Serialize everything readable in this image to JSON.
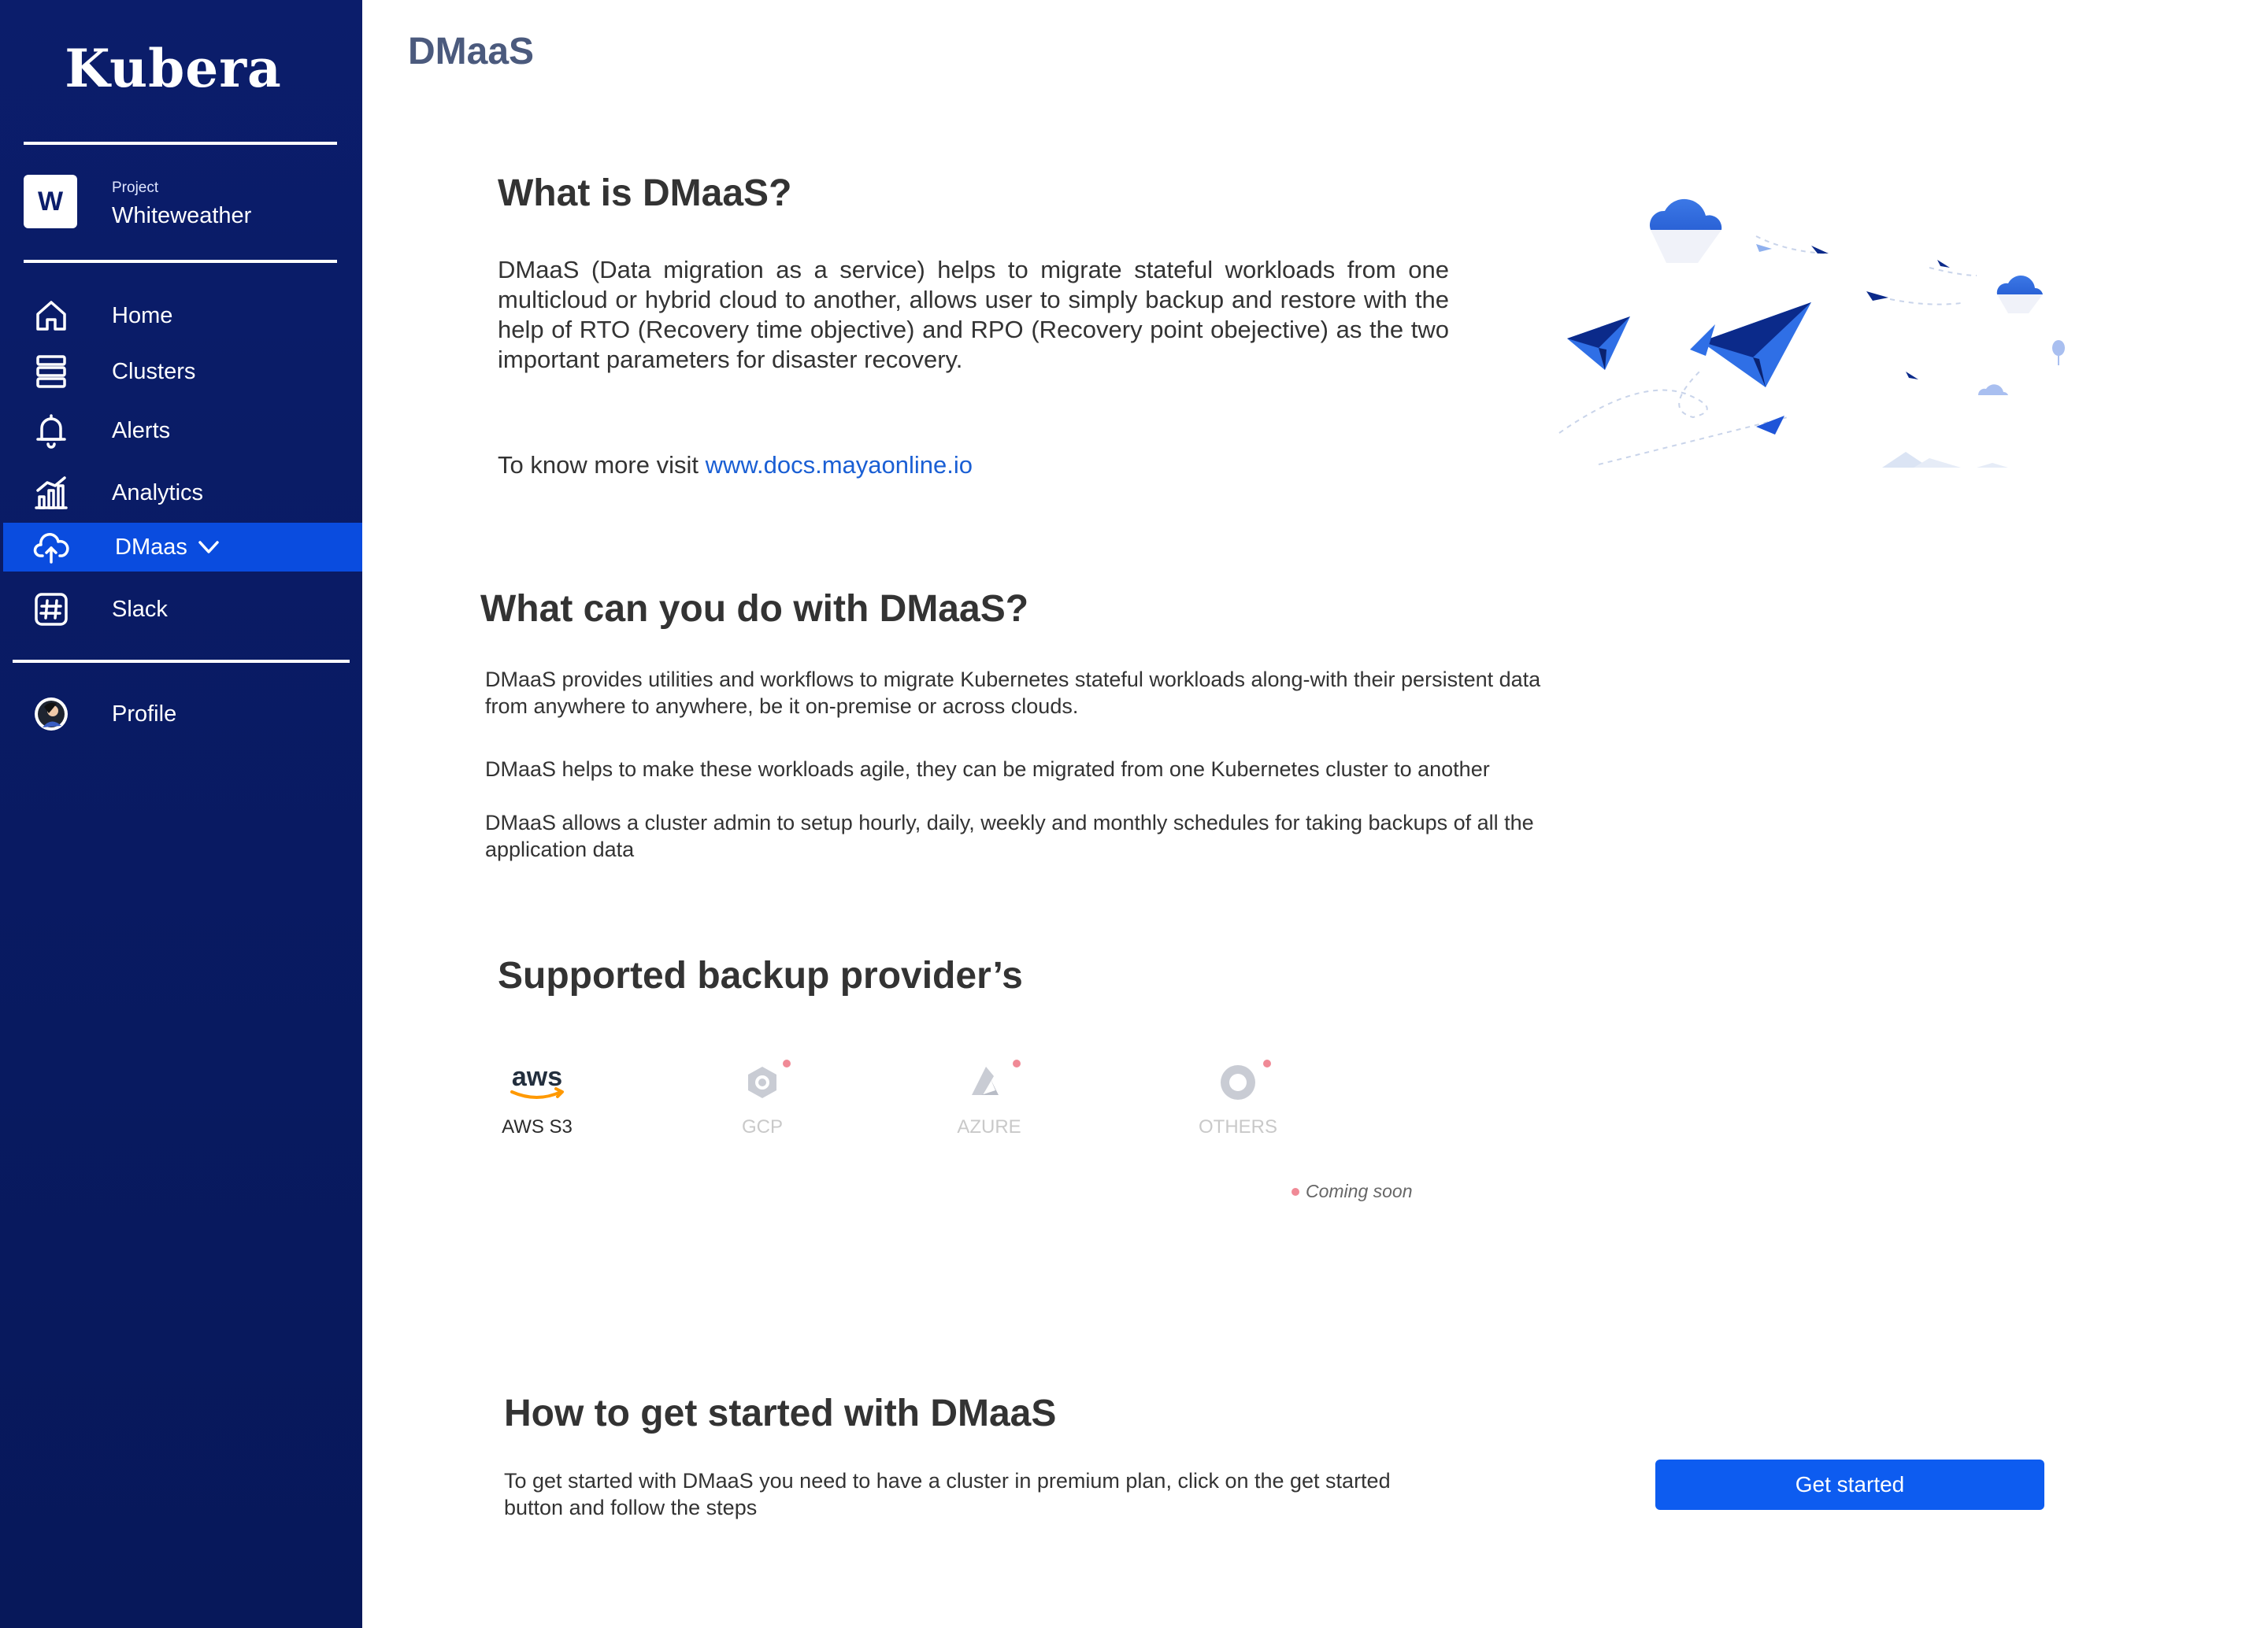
{
  "sidebar": {
    "brand": "Kubera",
    "project": {
      "initial": "W",
      "caption": "Project",
      "name": "Whiteweather"
    },
    "items": [
      {
        "label": "Home",
        "icon": "home-icon"
      },
      {
        "label": "Clusters",
        "icon": "server-stack-icon"
      },
      {
        "label": "Alerts",
        "icon": "bell-icon"
      },
      {
        "label": "Analytics",
        "icon": "bar-chart-icon"
      },
      {
        "label": "DMaas",
        "icon": "cloud-sync-icon",
        "active": true
      },
      {
        "label": "Slack",
        "icon": "slack-icon"
      }
    ],
    "profile": {
      "label": "Profile",
      "icon": "user-avatar"
    },
    "colors": {
      "background": "#0b1d6b",
      "active": "#0a4cdf"
    }
  },
  "main": {
    "page_title": "DMaaS",
    "what_is": {
      "heading": "What is DMaaS?",
      "body": "DMaaS (Data migration as a service) helps to migrate stateful workloads from one multicloud or hybrid cloud to another, allows user to simply backup and restore with the help of RTO (Recovery time objective) and RPO (Recovery point obejective) as the two important parameters for disaster recovery.",
      "more_prefix": "To know more visit ",
      "more_link": "www.docs.mayaonline.io"
    },
    "what_can": {
      "heading": "What can you do with DMaaS?",
      "points": [
        "DMaaS provides utilities and workflows to migrate Kubernetes stateful workloads along-with their persistent data from anywhere to anywhere, be it on-premise or across clouds.",
        "DMaaS helps to make these workloads agile, they can be migrated from one Kubernetes cluster to another",
        "DMaaS allows a cluster admin to setup hourly, daily, weekly and monthly schedules for taking backups of all the application data"
      ]
    },
    "providers": {
      "heading": "Supported backup provider’s",
      "items": [
        {
          "label": "AWS S3",
          "logo_text": "aws",
          "icon": "aws-logo",
          "available": true
        },
        {
          "label": "GCP",
          "icon": "gcp-icon",
          "available": false
        },
        {
          "label": "AZURE",
          "icon": "azure-icon",
          "available": false
        },
        {
          "label": "OTHERS",
          "icon": "others-icon",
          "available": false
        }
      ],
      "coming_soon": "Coming soon"
    },
    "get_started": {
      "heading": "How to get started with DMaaS",
      "body": "To get started with DMaaS you need to have a cluster in premium plan, click on the get started button and follow the steps",
      "button": "Get started"
    },
    "colors": {
      "accent": "#0d5cf0",
      "link": "#1a5fd4",
      "coming_soon_dot": "#f08a96"
    }
  }
}
